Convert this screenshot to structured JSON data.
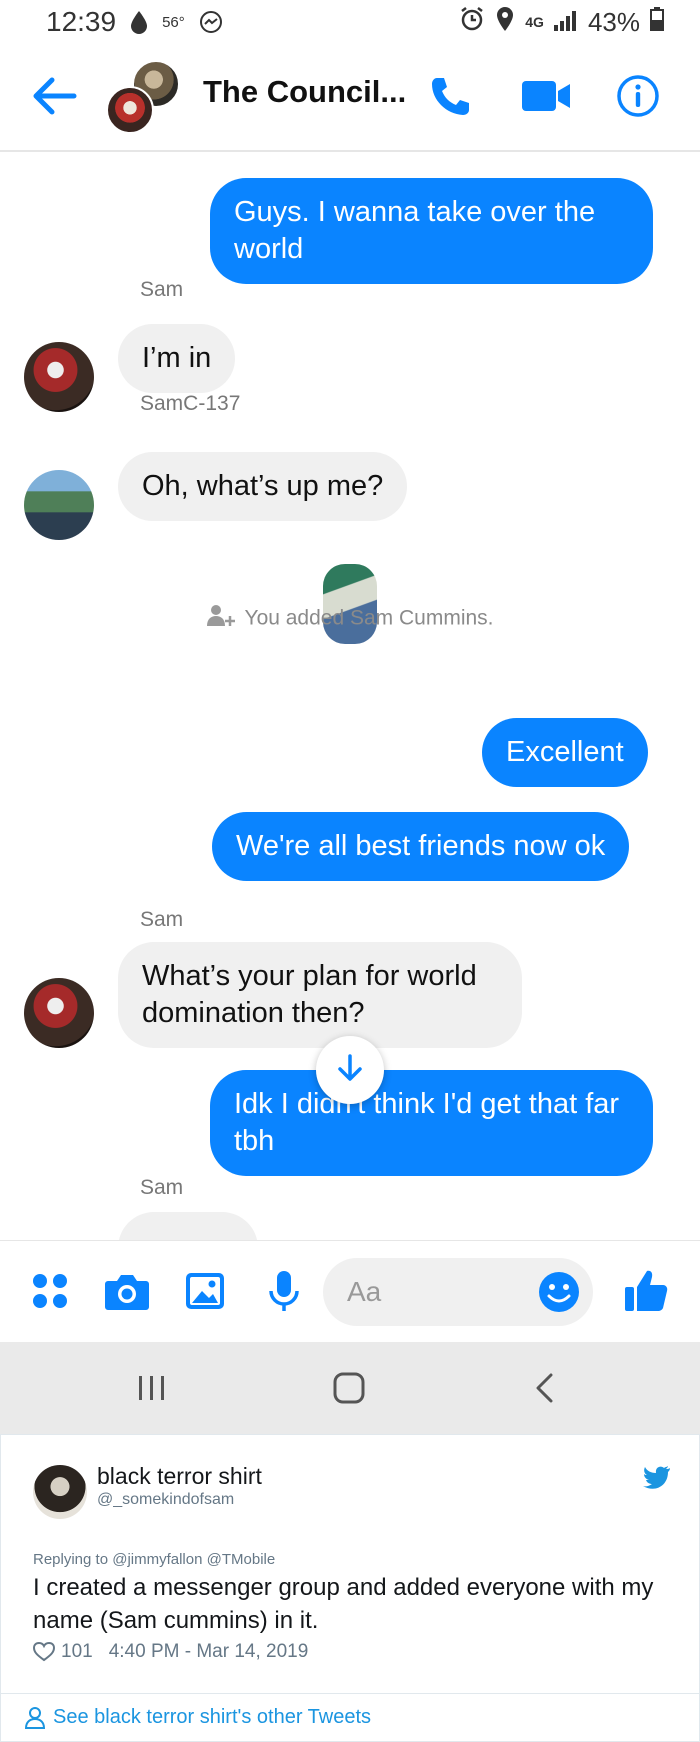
{
  "status_bar": {
    "time": "12:39",
    "temperature": "56°",
    "network": "4G",
    "battery": "43%"
  },
  "header": {
    "title": "The Council..."
  },
  "messages": [
    {
      "text": "Guys. I wanna take over the world"
    },
    {
      "sender": "Sam",
      "text": "I’m in"
    },
    {
      "sender": "SamC-137",
      "text": "Oh, what’s up me?"
    },
    {
      "system": "You added Sam Cummins."
    },
    {
      "text": "Excellent"
    },
    {
      "text": "We're all best friends now ok"
    },
    {
      "sender": "Sam",
      "text": "What’s your plan for world domination then?"
    },
    {
      "text": "Idk I didn't think I'd get that far tbh"
    },
    {
      "sender": "Sam"
    }
  ],
  "composer": {
    "placeholder": "Aa"
  },
  "tweet": {
    "name": "black terror shirt",
    "handle": "@_somekindofsam",
    "replying_to": "Replying to @jimmyfallon @TMobile",
    "text": "I created a messenger group and added everyone with my name (Sam cummins) in it.",
    "likes": "101",
    "timestamp": "4:40 PM - Mar 14, 2019",
    "footer_link": "See black terror shirt's other Tweets"
  },
  "colors": {
    "accent": "#0a84ff",
    "incoming_bubble": "#f0f0f0",
    "twitter_blue": "#1b95e0"
  }
}
